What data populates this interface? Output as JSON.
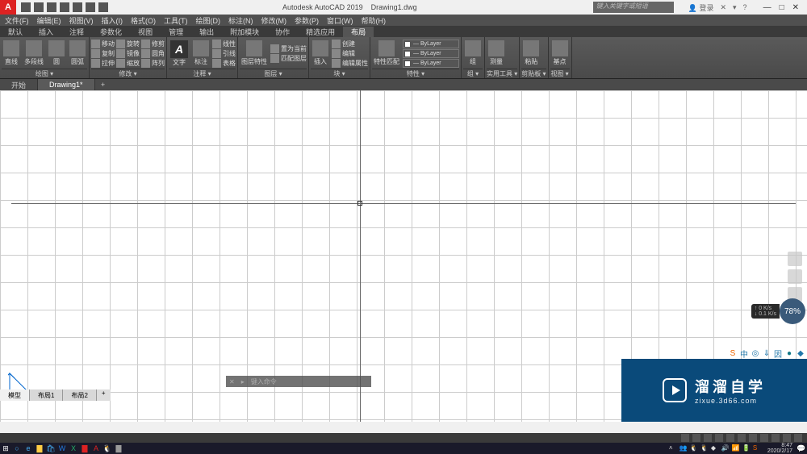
{
  "title": {
    "app": "Autodesk AutoCAD 2019",
    "doc": "Drawing1.dwg",
    "search_placeholder": "键入关键字或短语",
    "login": "登录"
  },
  "menu": {
    "items": [
      "文件(F)",
      "编辑(E)",
      "视图(V)",
      "插入(I)",
      "格式(O)",
      "工具(T)",
      "绘图(D)",
      "标注(N)",
      "修改(M)",
      "参数(P)",
      "窗口(W)",
      "帮助(H)"
    ]
  },
  "tabs": {
    "items": [
      "默认",
      "插入",
      "注释",
      "参数化",
      "视图",
      "管理",
      "输出",
      "附加模块",
      "协作",
      "精选应用",
      "布局"
    ],
    "active": 10
  },
  "ribbon": {
    "panels": [
      {
        "label": "绘图 ▾",
        "items": [
          {
            "label": "直线"
          },
          {
            "label": "多段线"
          },
          {
            "label": "圆"
          },
          {
            "label": "圆弧"
          }
        ]
      },
      {
        "label": "修改 ▾",
        "rows": [
          [
            "移动",
            "旋转",
            "修剪"
          ],
          [
            "复制",
            "镜像",
            "圆角"
          ],
          [
            "拉伸",
            "缩放",
            "阵列"
          ]
        ]
      },
      {
        "label": "注释 ▾",
        "items": [
          {
            "label": "文字"
          },
          {
            "label": "标注"
          }
        ],
        "rows": [
          [
            "线性"
          ],
          [
            "引线"
          ],
          [
            "表格"
          ]
        ]
      },
      {
        "label": "图层 ▾",
        "items": [
          {
            "label": "图层特性"
          }
        ],
        "rows": [
          [
            "置为当前"
          ],
          [
            "匹配图层"
          ]
        ]
      },
      {
        "label": "块 ▾",
        "items": [
          {
            "label": "插入"
          }
        ],
        "rows": [
          [
            "创建"
          ],
          [
            "编辑"
          ],
          [
            "编辑属性"
          ]
        ]
      },
      {
        "label": "特性 ▾",
        "dropdowns": [
          "ByLayer",
          "ByLayer",
          "ByLayer"
        ],
        "items": [
          {
            "label": "特性匹配"
          }
        ]
      },
      {
        "label": "组 ▾",
        "items": [
          {
            "label": "组"
          }
        ]
      },
      {
        "label": "实用工具 ▾",
        "items": [
          {
            "label": "测量"
          }
        ]
      },
      {
        "label": "剪贴板 ▾",
        "items": [
          {
            "label": "粘贴"
          }
        ]
      },
      {
        "label": "视图 ▾",
        "items": [
          {
            "label": "基点"
          }
        ]
      }
    ]
  },
  "file_tabs": {
    "items": [
      {
        "label": "开始",
        "active": false
      },
      {
        "label": "Drawing1*",
        "active": true
      }
    ]
  },
  "speed": {
    "up": "0 K/s",
    "down": "0.1 K/s",
    "pct": "78%"
  },
  "watermark": {
    "title": "溜溜自学",
    "url": "zixue.3d66.com"
  },
  "command": {
    "prompt": "键入命令"
  },
  "layout_tabs": {
    "items": [
      {
        "label": "模型",
        "active": true
      },
      {
        "label": "布局1",
        "active": false
      },
      {
        "label": "布局2",
        "active": false
      }
    ]
  },
  "clock": {
    "time": "8:47",
    "date": "2020/2/17"
  },
  "side_icons": [
    "S",
    "中",
    "◎",
    "⇓",
    "因",
    "●",
    "◆"
  ],
  "side_colors": [
    "#e60",
    "#27a",
    "#27a",
    "#27a",
    "#27a",
    "#178",
    "#27a"
  ]
}
